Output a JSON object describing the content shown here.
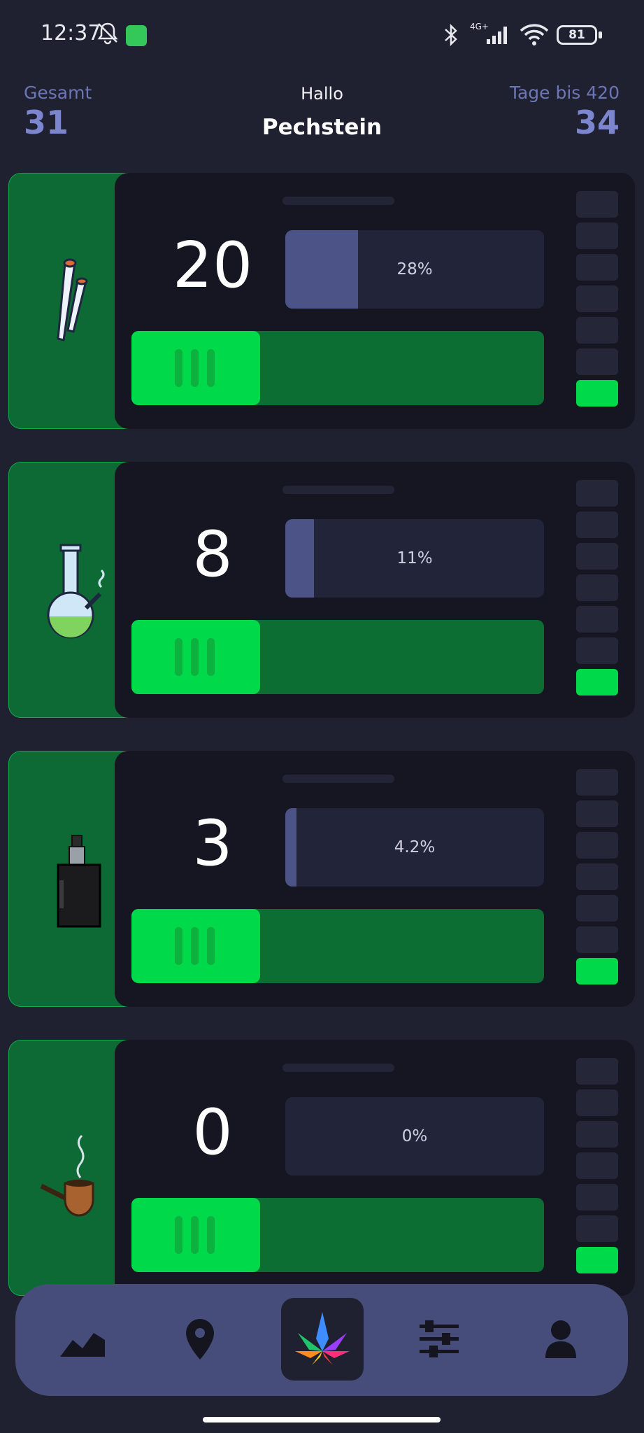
{
  "status_bar": {
    "time": "12:37",
    "network": "4G+",
    "battery": "81"
  },
  "header": {
    "left_label": "Gesamt",
    "left_value": "31",
    "greeting": "Hallo",
    "name": "Pechstein",
    "right_label": "Tage bis 420",
    "right_value": "34"
  },
  "cards": [
    {
      "item": "joint-icon",
      "count": "20",
      "percent_label": "28%",
      "percent": 28
    },
    {
      "item": "bong-icon",
      "count": "8",
      "percent_label": "11%",
      "percent": 11
    },
    {
      "item": "vape-icon",
      "count": "3",
      "percent_label": "4.2%",
      "percent": 4.2
    },
    {
      "item": "pipe-icon",
      "count": "0",
      "percent_label": "0%",
      "percent": 0
    }
  ],
  "nav": {
    "items": [
      "stats-icon",
      "location-icon",
      "cannabis-leaf-icon",
      "settings-sliders-icon",
      "profile-icon"
    ],
    "active": "cannabis-leaf-icon"
  },
  "colors": {
    "background": "#1f2030",
    "accent_green": "#00d94a",
    "dark_green": "#0c6e33",
    "accent_blue": "#7c86cf",
    "nav_bg": "#474d7a"
  }
}
